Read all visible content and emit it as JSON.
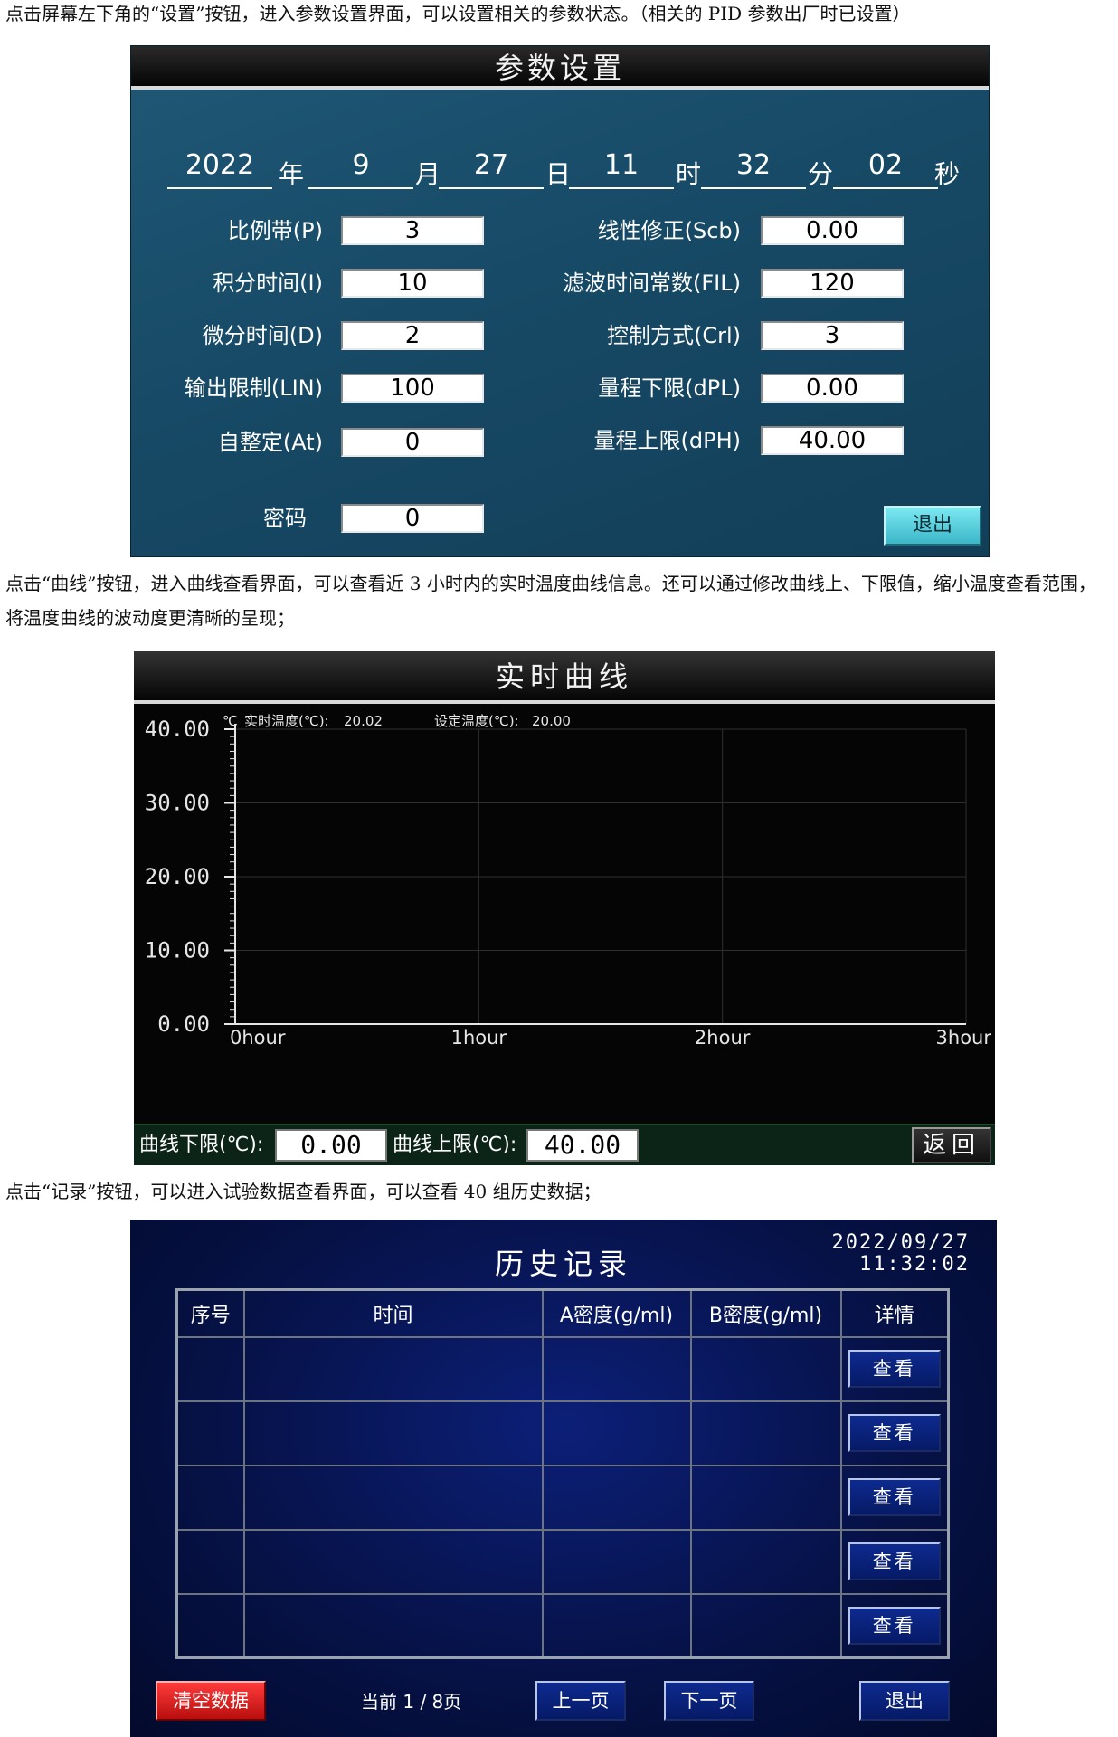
{
  "captions": {
    "settings": "点击屏幕左下角的“设置”按钮，进入参数设置界面，可以设置相关的参数状态。（相关的 PID 参数出厂时已设置）",
    "curve": "点击“曲线”按钮，进入曲线查看界面，可以查看近 3 小时内的实时温度曲线信息。还可以通过修改曲线上、下限值，缩小温度查看范围，将温度曲线的波动度更清晰的呈现；",
    "history": "点击“记录”按钮，可以进入试验数据查看界面，可以查看 40 组历史数据；"
  },
  "settings": {
    "title": "参数设置",
    "datetime": {
      "year": "2022",
      "year_unit": "年",
      "month": "9",
      "month_unit": "月",
      "day": "27",
      "day_unit": "日",
      "hour": "11",
      "hour_unit": "时",
      "minute": "32",
      "minute_unit": "分",
      "second": "02",
      "second_unit": "秒"
    },
    "left_params": [
      {
        "label": "比例带(P)",
        "value": "3"
      },
      {
        "label": "积分时间(I)",
        "value": "10"
      },
      {
        "label": "微分时间(D)",
        "value": "2"
      },
      {
        "label": "输出限制(LIN)",
        "value": "100"
      },
      {
        "label": "自整定(At)",
        "value": "0"
      }
    ],
    "right_params": [
      {
        "label": "线性修正(Scb)",
        "value": "0.00"
      },
      {
        "label": "滤波时间常数(FIL)",
        "value": "120"
      },
      {
        "label": "控制方式(Crl)",
        "value": "3"
      },
      {
        "label": "量程下限(dPL)",
        "value": "0.00"
      },
      {
        "label": "量程上限(dPH)",
        "value": "40.00"
      }
    ],
    "password_label": "密码",
    "password_value": "0",
    "exit_label": "退出"
  },
  "curve": {
    "title": "实时曲线",
    "unit_symbol": "℃",
    "realtime_label": "实时温度(℃):",
    "realtime_value": "20.02",
    "setpoint_label": "设定温度(℃):",
    "setpoint_value": "20.00",
    "lower_label": "曲线下限(℃):",
    "lower_value": "0.00",
    "upper_label": "曲线上限(℃):",
    "upper_value": "40.00",
    "back_label": "返回",
    "colors": {
      "setpoint": "#2ecc40",
      "grid": "#2f2f2f"
    }
  },
  "chart_data": {
    "type": "line",
    "x_ticks": [
      "0hour",
      "1hour",
      "2hour",
      "3hour"
    ],
    "y_ticks": [
      "40.00",
      "30.00",
      "20.00",
      "10.00",
      "0.00"
    ],
    "ylim": [
      0,
      40
    ],
    "series": [],
    "grid": true
  },
  "history": {
    "title": "历史记录",
    "date": "2022/09/27",
    "time": "11:32:02",
    "columns": [
      "序号",
      "时间",
      "A密度(g/ml)",
      "B密度(g/ml)",
      "详情"
    ],
    "rows": [
      {
        "view_label": "查看"
      },
      {
        "view_label": "查看"
      },
      {
        "view_label": "查看"
      },
      {
        "view_label": "查看"
      },
      {
        "view_label": "查看"
      }
    ],
    "clear_label": "清空数据",
    "page_info": "当前  1  /  8页",
    "prev_label": "上一页",
    "next_label": "下一页",
    "exit_label": "退出"
  }
}
